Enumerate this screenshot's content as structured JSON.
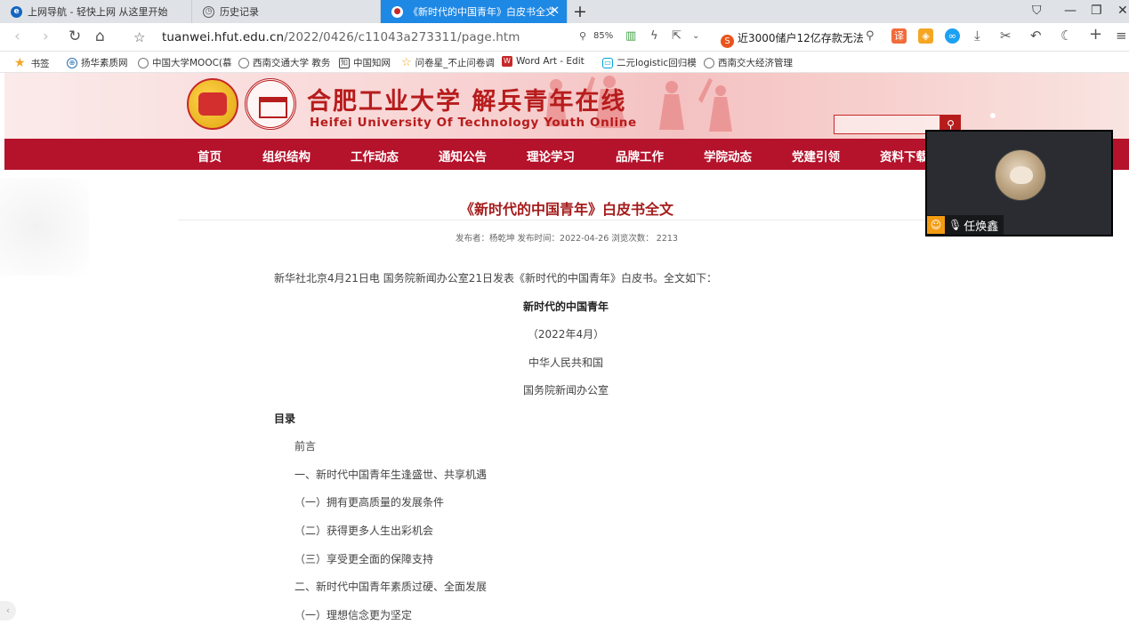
{
  "browser": {
    "tabs": [
      {
        "label": "上网导航 - 轻快上网 从这里开始",
        "icon": "ie-icon"
      },
      {
        "label": "历史记录",
        "icon": "clock-icon"
      },
      {
        "label": "《新时代的中国青年》白皮书全文",
        "icon": "site-favicon",
        "active": true
      }
    ],
    "url_host": "tuanwei.hfut.edu.cn",
    "url_path": "/2022/0426/c11043a273311/page.htm",
    "zoom": "85%",
    "news_ticker": "近3000储户12亿存款无法",
    "bookmarks": [
      {
        "label": "书签",
        "icon": "star-icon"
      },
      {
        "label": "扬华素质网",
        "icon": "globe-icon"
      },
      {
        "label": "中国大学MOOC(慕",
        "icon": "globe-icon"
      },
      {
        "label": "西南交通大学 教务",
        "icon": "globe-icon"
      },
      {
        "label": "中国知网",
        "icon": "cnki-icon"
      },
      {
        "label": "问卷星_不止问卷调",
        "icon": "wjx-icon"
      },
      {
        "label": "Word Art - Edit",
        "icon": "wordart-icon"
      },
      {
        "label": "二元logistic回归模",
        "icon": "bilibili-icon"
      },
      {
        "label": "西南交大经济管理",
        "icon": "globe-icon"
      }
    ]
  },
  "site": {
    "title_cn": "合肥工业大学 解兵青年在线",
    "title_en": "Heifei University Of Technology Youth Online",
    "nav": [
      "首页",
      "组织结构",
      "工作动态",
      "通知公告",
      "理论学习",
      "品牌工作",
      "学院动态",
      "党建引领",
      "资料下载"
    ]
  },
  "article": {
    "title": "《新时代的中国青年》白皮书全文",
    "meta": "发布者：杨乾坤    发布时间：2022-04-26    浏览次数：  2213",
    "intro": "新华社北京4月21日电 国务院新闻办公室21日发表《新时代的中国青年》白皮书。全文如下：",
    "doc_title": "新时代的中国青年",
    "doc_date": "（2022年4月）",
    "doc_issuer1": "中华人民共和国",
    "doc_issuer2": "国务院新闻办公室",
    "toc_heading": "目录",
    "toc": [
      "前言",
      "一、新时代中国青年生逢盛世、共享机遇",
      "（一）拥有更高质量的发展条件",
      "（二）获得更多人生出彩机会",
      "（三）享受更全面的保障支持",
      "二、新时代中国青年素质过硬、全面发展",
      "（一）理想信念更为坚定"
    ]
  },
  "video": {
    "participant_name": "任焕鑫"
  },
  "colors": {
    "active_tab": "#1e88e5",
    "brand_red": "#b5122b",
    "title_red": "#a51c1c"
  }
}
